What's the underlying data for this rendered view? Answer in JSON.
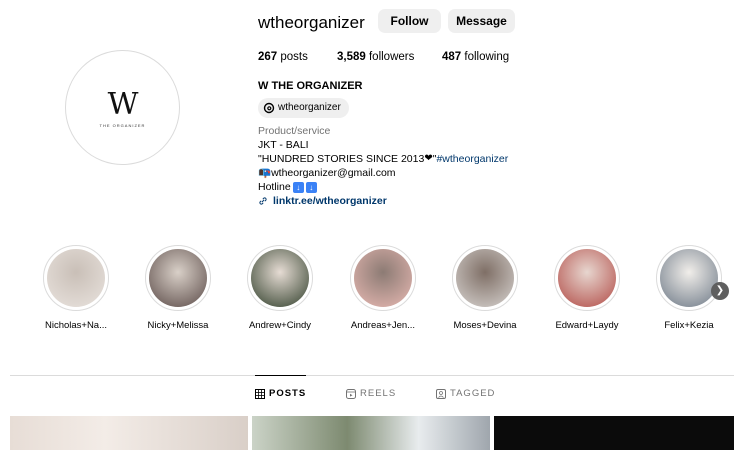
{
  "profile": {
    "username": "wtheorganizer",
    "follow_label": "Follow",
    "message_label": "Message",
    "posts_count": "267",
    "posts_label": " posts",
    "followers_count": "3,589",
    "followers_label": " followers",
    "following_count": "487",
    "following_label": " following",
    "full_name": "W THE ORGANIZER",
    "threads_handle": "wtheorganizer",
    "logo_letter": "W",
    "logo_text": "THE ORGANIZER"
  },
  "bio": {
    "category": "Product/service",
    "line1": "JKT - BALI",
    "line2": "\"HUNDRED STORIES SINCE 2013 ",
    "line2_heart": "❤",
    "line2_tail": "\" ",
    "hashtag": "#wtheorganizer",
    "email_prefix_icon": "📭",
    "email": " wtheorganizer@gmail.com",
    "hotline": "Hotline ",
    "arrow1": "↓",
    "arrow2": "↓",
    "link": "linktr.ee/wtheorganizer"
  },
  "highlights": [
    {
      "label": "Nicholas+Na...",
      "colors": [
        "#e9e3de",
        "#c9bfb7"
      ]
    },
    {
      "label": "Nicky+Melissa",
      "colors": [
        "#5a4a47",
        "#d9d0c8"
      ]
    },
    {
      "label": "Andrew+Cindy",
      "colors": [
        "#2f3e2a",
        "#e6dcd4"
      ]
    },
    {
      "label": "Andreas+Jen...",
      "colors": [
        "#e8b9b3",
        "#8c7b74"
      ]
    },
    {
      "label": "Moses+Devina",
      "colors": [
        "#d8d4d1",
        "#7f6f66"
      ]
    },
    {
      "label": "Edward+Laydy",
      "colors": [
        "#b14a45",
        "#e7d6cf"
      ]
    },
    {
      "label": "Felix+Kezia",
      "colors": [
        "#6b7785",
        "#f1eeea"
      ]
    }
  ],
  "tabs": {
    "posts": "POSTS",
    "reels": "REELS",
    "tagged": "TAGGED"
  },
  "icons": {
    "next": "chevron-right-icon"
  }
}
